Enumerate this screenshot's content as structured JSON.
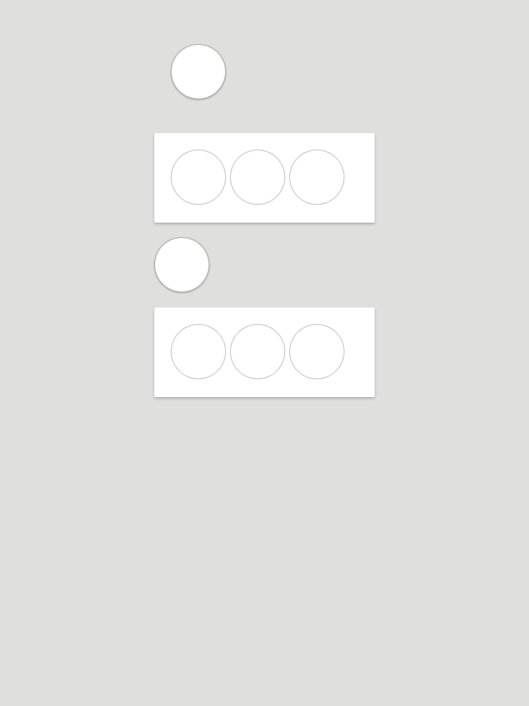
{
  "colors": {
    "background": "#dfe0de",
    "card": "#ffffff",
    "circle_border": "#9a9a98"
  },
  "elements": {
    "floating_circles": 2,
    "cards": [
      {
        "circles": 3
      },
      {
        "circles": 3
      }
    ]
  }
}
